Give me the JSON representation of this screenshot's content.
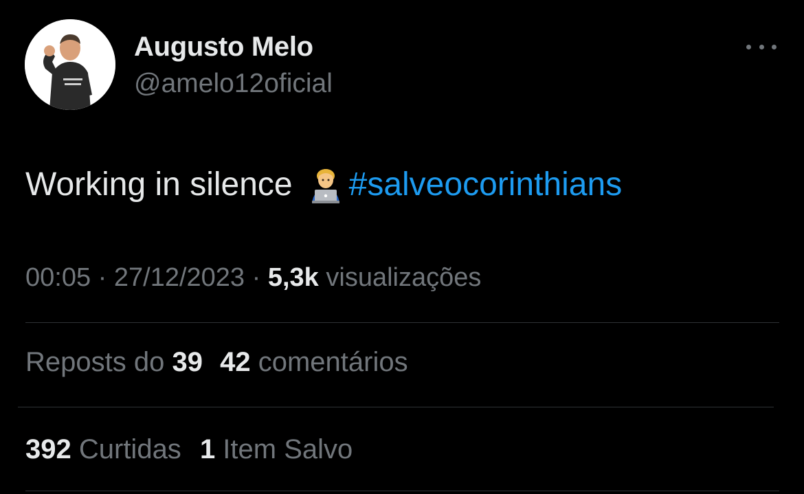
{
  "author": {
    "display_name": "Augusto Melo",
    "handle": "@amelo12oficial"
  },
  "tweet": {
    "text": "Working in silence",
    "emoji": "man-technologist-emoji",
    "hashtag": "#salveocorinthians"
  },
  "meta": {
    "time": "00:05",
    "sep1": " · ",
    "date": "27/12/2023",
    "sep2": " · ",
    "views_count": "5,3k",
    "views_label": " visualizações"
  },
  "stats": {
    "reposts_label": "Reposts do ",
    "reposts_count": "39",
    "comments_count": "42",
    "comments_label": " comentários",
    "likes_count": "392",
    "likes_label": " Curtidas",
    "saved_count": "1",
    "saved_label": " Item Salvo"
  },
  "colors": {
    "background": "#000000",
    "primary_text": "#e7e9ea",
    "secondary_text": "#71767b",
    "link": "#1d9bf0",
    "divider": "#2f3336"
  },
  "icons": {
    "more": "more-horizontal-icon"
  }
}
